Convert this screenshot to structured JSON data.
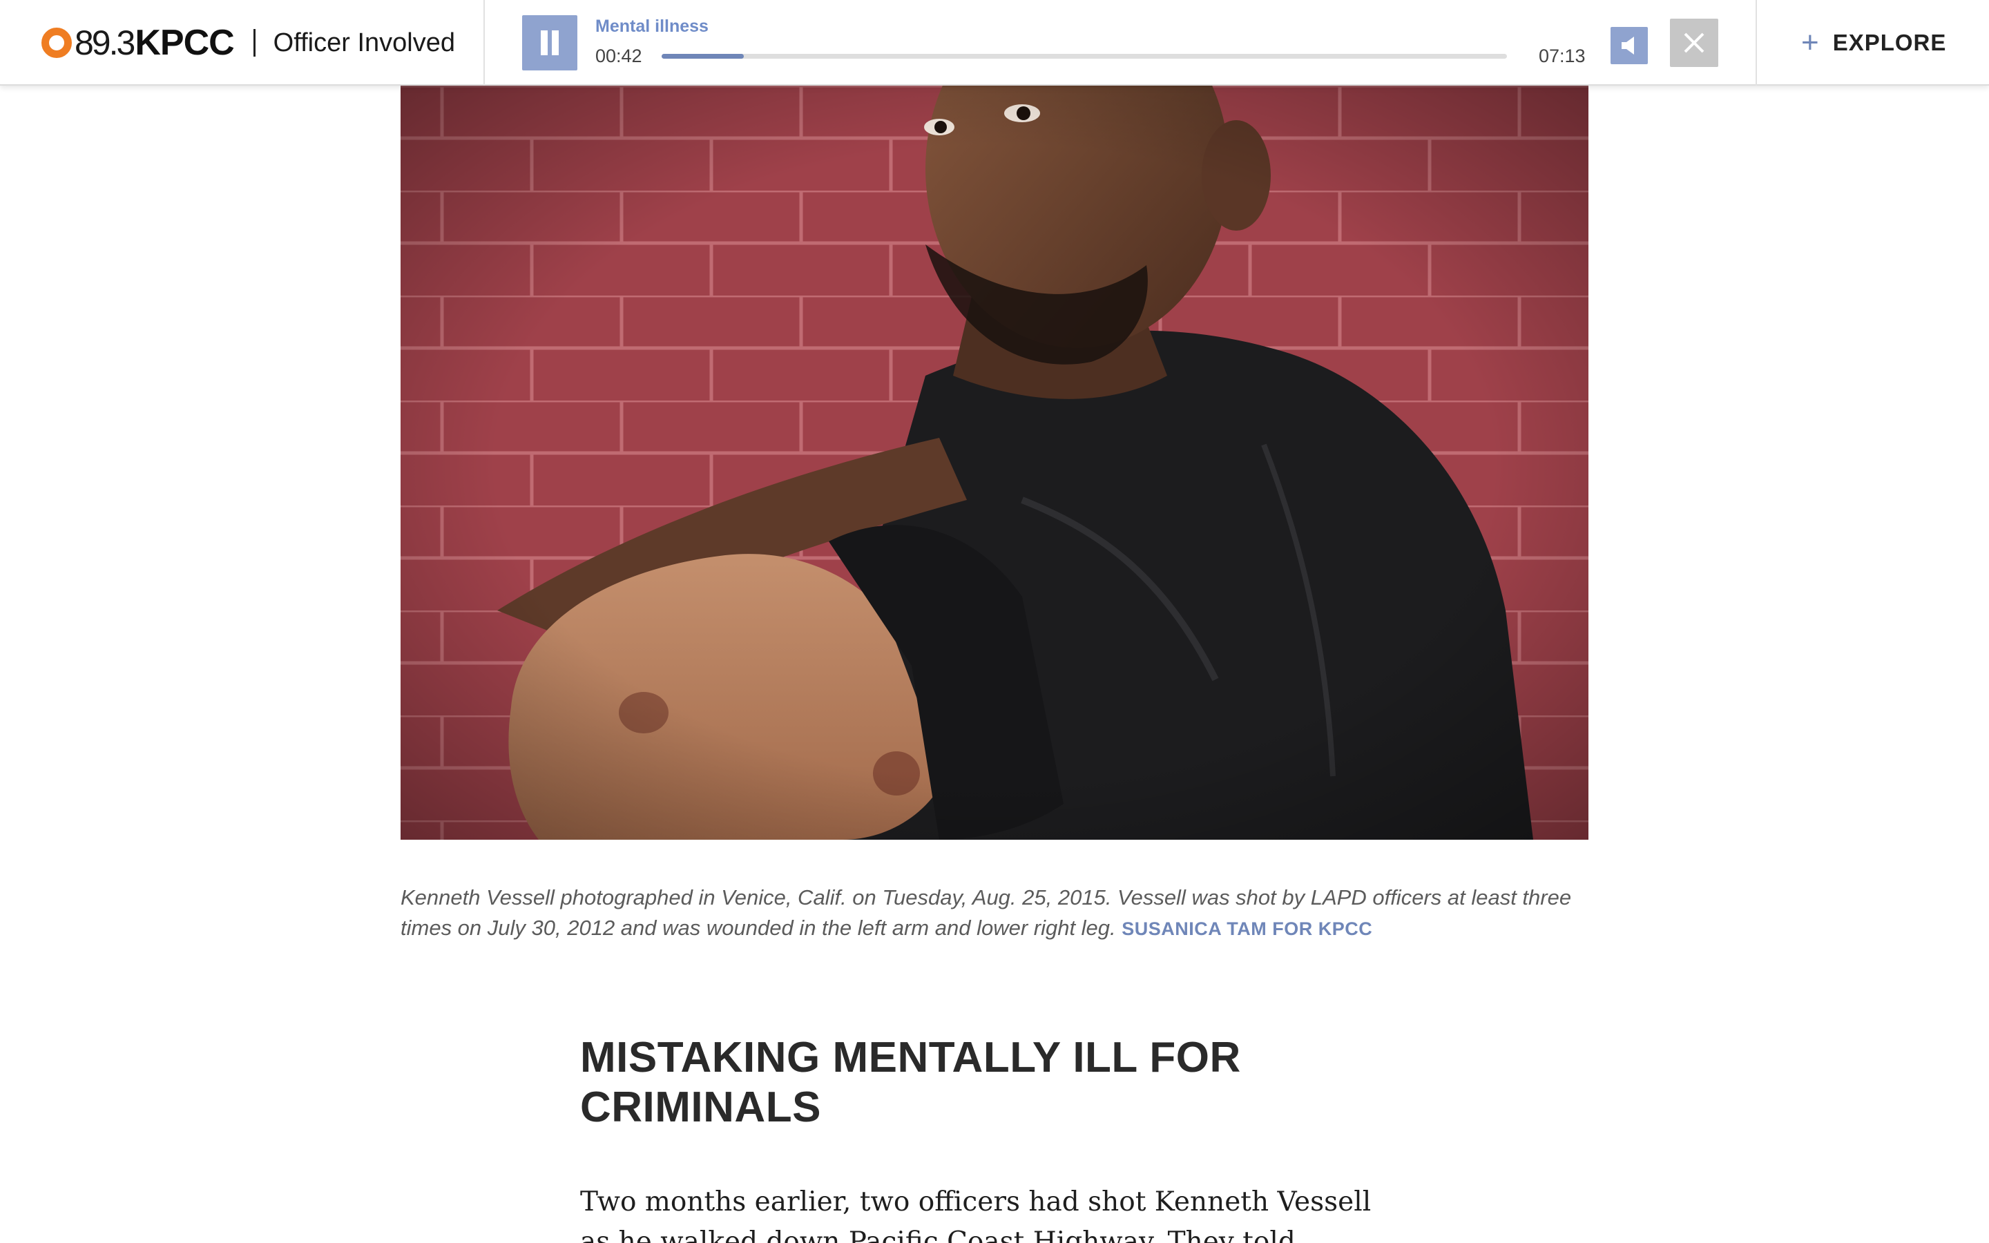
{
  "header": {
    "logo_freq": "89.3",
    "logo_call": "KPCC",
    "section_name": "Officer Involved",
    "explore_label": "EXPLORE"
  },
  "player": {
    "track_title": "Mental illness",
    "elapsed": "00:42",
    "duration": "07:13",
    "progress_fraction": 0.097,
    "state": "playing"
  },
  "photo": {
    "subject": "Kenneth Vessell"
  },
  "caption": {
    "text": "Kenneth Vessell photographed in Venice, Calif. on Tuesday, Aug. 25, 2015. Vessell was shot by LAPD officers at least three times on July 30, 2012 and was wounded in the left arm and lower right leg.",
    "credit": "SUSANICA TAM FOR KPCC"
  },
  "article": {
    "headline_line1": "MISTAKING MENTALLY ILL FOR",
    "headline_line2": "CRIMINALS",
    "paragraph1": "Two months earlier, two officers had shot Kenneth Vessell as he walked down Pacific Coast Highway. They told investigators he"
  },
  "colors": {
    "accent": "#6f86b8",
    "logo_orange": "#ef7d22",
    "button_blue": "#8fa3cf",
    "close_gray": "#c6c6c6"
  }
}
